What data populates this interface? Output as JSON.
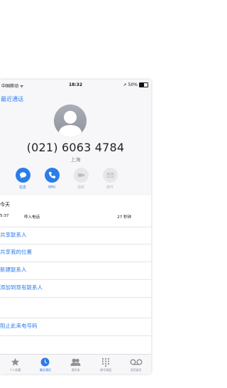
{
  "status_bar": {
    "carrier": "中国移动 ᯤ",
    "time": "18:32",
    "battery_text": "50%",
    "battery_level": 0.5
  },
  "nav": {
    "back_label": "最近通话"
  },
  "contact": {
    "number": "(021) 6063 4784",
    "location": "上海"
  },
  "actions": [
    {
      "label": "信息",
      "icon": "message-icon",
      "enabled": true
    },
    {
      "label": "呼叫",
      "icon": "phone-icon",
      "enabled": true
    },
    {
      "label": "视频",
      "icon": "video-icon",
      "enabled": false
    },
    {
      "label": "邮件",
      "icon": "mail-icon",
      "enabled": false
    }
  ],
  "call_log": {
    "day": "今天",
    "time": "5:37",
    "type": "呼入电话",
    "duration": "27 秒钟"
  },
  "options": [
    "共享联系人",
    "共享我的位置",
    "新建联系人",
    "添加到现有联系人",
    "阻止此来电号码"
  ],
  "tabs": [
    {
      "label": "个人收藏",
      "icon": "star-icon",
      "active": false
    },
    {
      "label": "最近通话",
      "icon": "clock-icon",
      "active": true
    },
    {
      "label": "通讯录",
      "icon": "contacts-icon",
      "active": false
    },
    {
      "label": "拨号键盘",
      "icon": "keypad-icon",
      "active": false
    },
    {
      "label": "语音留言",
      "icon": "voicemail-icon",
      "active": false
    }
  ],
  "colors": {
    "accent": "#2b7de9",
    "inactive": "#8e8e93"
  }
}
